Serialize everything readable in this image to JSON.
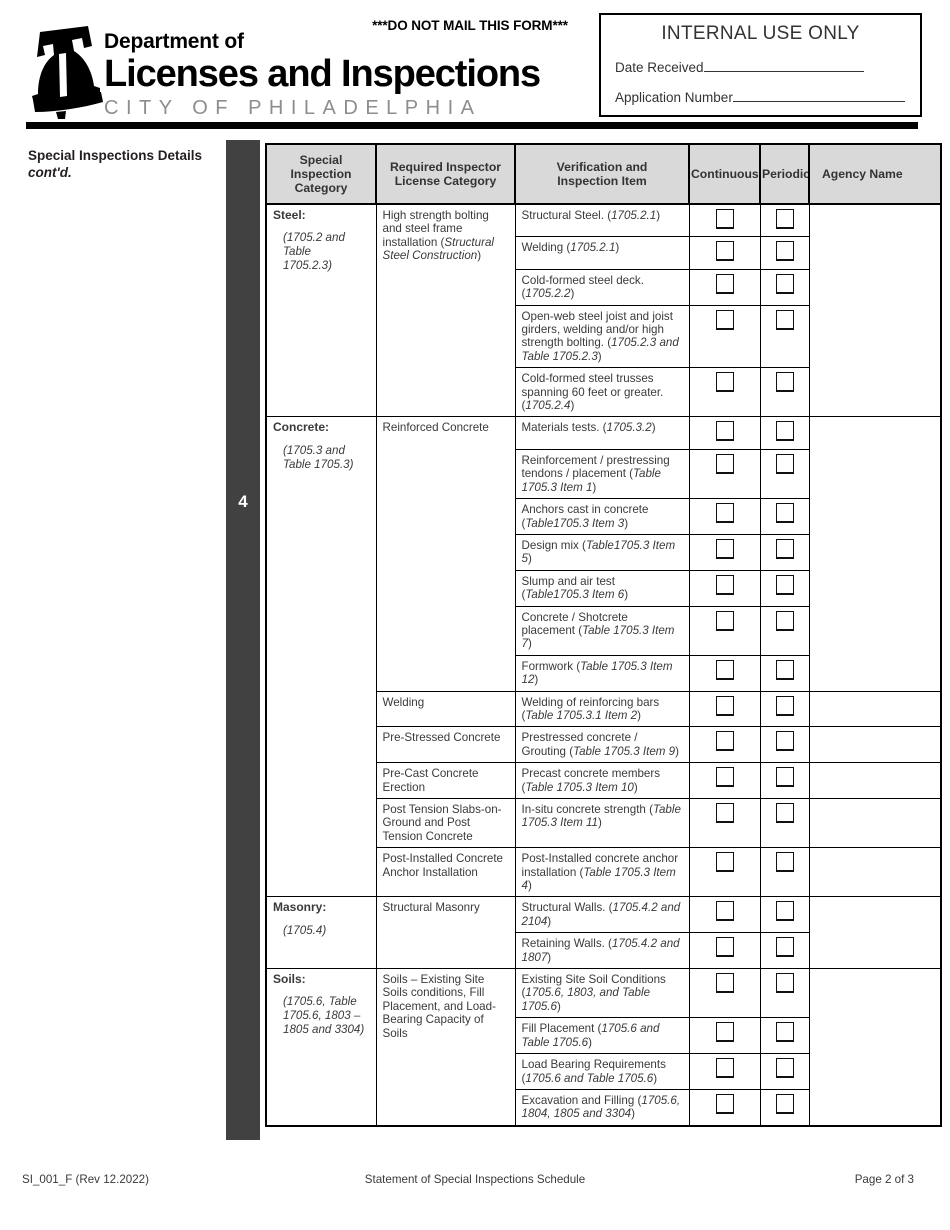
{
  "header": {
    "do_not_mail": "***DO NOT MAIL THIS FORM***",
    "dept_line1": "Department of",
    "dept_line2": "Licenses and Inspections",
    "dept_line3": "CITY OF PHILADELPHIA",
    "internal_box": {
      "title": "INTERNAL USE ONLY",
      "date_received_label": "Date Received",
      "application_number_label": "Application Number"
    }
  },
  "side": {
    "label_line1": "Special Inspections Details",
    "label_line2": "cont'd.",
    "step_number": "4"
  },
  "table": {
    "headers": [
      "Special Inspection Category",
      "Required Inspector License Category",
      "Verification and Inspection Item",
      "Continuous",
      "Periodic",
      "Agency Name"
    ],
    "header_wrapped": {
      "col1_l1": "Special",
      "col1_l2": "Inspection",
      "col1_l3": "Category",
      "col2_l1": "Required Inspector",
      "col2_l2": "License Category",
      "col3_l1": "Verification and",
      "col3_l2": "Inspection Item",
      "col4": "Continuous",
      "col5": "Periodic",
      "col6": "Agency Name"
    },
    "groups": [
      {
        "category_name": "Steel:",
        "category_ref_l1": "(1705.2 and Table",
        "category_ref_l2": "1705.2.3)",
        "license_groups": [
          {
            "license_plain": "High strength bolting and steel frame installation (",
            "license_italic": "Structural Steel Construction",
            "license_tail": ")",
            "items": [
              {
                "text": "Structural Steel. (",
                "ref": "1705.2.1",
                "tail": ")"
              },
              {
                "text": "Welding (",
                "ref": "1705.2.1",
                "tail": ")"
              },
              {
                "text": "Cold-formed steel deck. (",
                "ref": "1705.2.2",
                "tail": ")"
              },
              {
                "text": "Open-web steel joist and joist girders, welding and/or high strength bolting. (",
                "ref": "1705.2.3 and Table 1705.2.3",
                "tail": ")"
              },
              {
                "text": "Cold-formed steel trusses spanning 60 feet or greater. (",
                "ref": "1705.2.4",
                "tail": ")"
              }
            ]
          }
        ]
      },
      {
        "category_name": "Concrete:",
        "category_ref_l1": "(1705.3 and",
        "category_ref_l2": "Table 1705.3)",
        "license_groups": [
          {
            "license_plain": "Reinforced Concrete",
            "license_italic": "",
            "license_tail": "",
            "items": [
              {
                "text": "Materials tests. (",
                "ref": "1705.3.2",
                "tail": ")"
              },
              {
                "text": "Reinforcement / prestressing tendons / placement (",
                "ref": "Table 1705.3 Item 1",
                "tail": ")"
              },
              {
                "text": "Anchors cast in concrete (",
                "ref": "Table1705.3 Item 3",
                "tail": ")"
              },
              {
                "text": "Design mix (",
                "ref": "Table1705.3 Item 5",
                "tail": ")"
              },
              {
                "text": "Slump and air test (",
                "ref": "Table1705.3 Item 6",
                "tail": ")"
              },
              {
                "text": "Concrete / Shotcrete placement (",
                "ref": "Table 1705.3 Item 7",
                "tail": ")"
              },
              {
                "text": "Formwork (",
                "ref": "Table 1705.3 Item 12",
                "tail": ")"
              }
            ]
          },
          {
            "license_plain": "Welding",
            "license_italic": "",
            "license_tail": "",
            "items": [
              {
                "text": "Welding of reinforcing bars (",
                "ref": "Table 1705.3.1 Item 2",
                "tail": ")"
              }
            ]
          },
          {
            "license_plain": "Pre-Stressed Concrete",
            "license_italic": "",
            "license_tail": "",
            "items": [
              {
                "text": "Prestressed concrete / Grouting (",
                "ref": "Table 1705.3 Item 9",
                "tail": ")"
              }
            ]
          },
          {
            "license_plain": "Pre-Cast Concrete Erection",
            "license_italic": "",
            "license_tail": "",
            "items": [
              {
                "text": "Precast concrete members (",
                "ref": "Table 1705.3 Item 10",
                "tail": ")"
              }
            ]
          },
          {
            "license_plain": "Post Tension Slabs-on-Ground and Post Tension Concrete",
            "license_italic": "",
            "license_tail": "",
            "items": [
              {
                "text": "In-situ concrete strength (",
                "ref": "Table 1705.3 Item 11",
                "tail": ")"
              }
            ]
          },
          {
            "license_plain": "Post-Installed Concrete Anchor Installation",
            "license_italic": "",
            "license_tail": "",
            "items": [
              {
                "text": "Post-Installed concrete anchor installation (",
                "ref": "Table 1705.3 Item 4",
                "tail": ")"
              }
            ]
          }
        ]
      },
      {
        "category_name": "Masonry:",
        "category_ref_l1": "(1705.4)",
        "category_ref_l2": "",
        "license_groups": [
          {
            "license_plain": "Structural Masonry",
            "license_italic": "",
            "license_tail": "",
            "items": [
              {
                "text": "Structural Walls. (",
                "ref": "1705.4.2 and 2104",
                "tail": ")"
              },
              {
                "text": "Retaining Walls. (",
                "ref": "1705.4.2 and 1807",
                "tail": ")"
              }
            ]
          }
        ]
      },
      {
        "category_name": "Soils:",
        "category_ref_l1": "(1705.6, Table 1705.6, 1803 –",
        "category_ref_l2": "1805 and 3304)",
        "license_groups": [
          {
            "license_plain": "Soils – Existing Site Soils conditions, Fill Placement, and Load-Bearing Capacity of Soils",
            "license_italic": "",
            "license_tail": "",
            "items": [
              {
                "text": "Existing Site Soil Conditions (",
                "ref": "1705.6, 1803, and Table 1705.6",
                "tail": ")"
              },
              {
                "text": "Fill Placement (",
                "ref": "1705.6 and Table 1705.6",
                "tail": ")"
              },
              {
                "text": "Load Bearing Requirements (",
                "ref": "1705.6 and Table 1705.6",
                "tail": ")"
              },
              {
                "text": "Excavation and Filling (",
                "ref": "1705.6, 1804, 1805 and 3304",
                "tail": ")"
              }
            ]
          }
        ]
      }
    ]
  },
  "footer": {
    "left": "SI_001_F (Rev 12.2022)",
    "center": "Statement of Special Inspections Schedule",
    "right": "Page 2 of 3"
  },
  "colors": {
    "header_fill": "#d9d9d9",
    "step_bar": "#414141",
    "rule": "#000000"
  }
}
